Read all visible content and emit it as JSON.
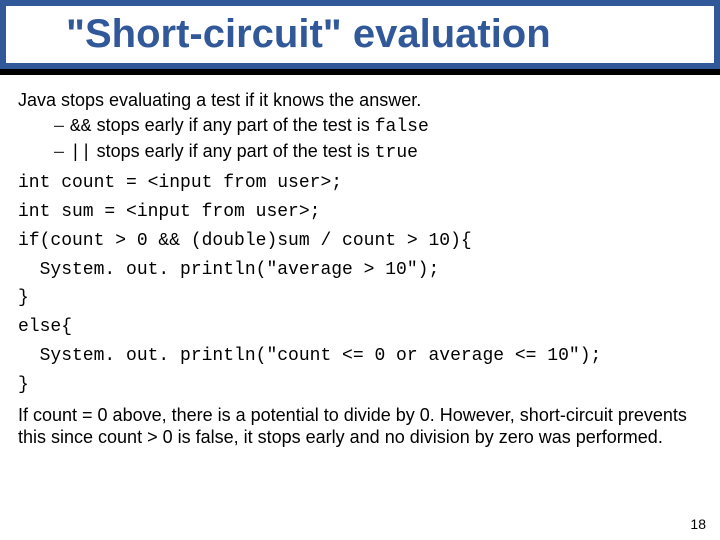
{
  "title": "\"Short-circuit\" evaluation",
  "lead": "Java stops evaluating a test if it knows the answer.",
  "bullets": [
    {
      "op": "&&",
      "text_before": "",
      "text_after": " stops early if any part of the test is ",
      "tail": "false"
    },
    {
      "op": "||",
      "text_before": "",
      "text_after": " stops early if any part of the test is ",
      "tail": "true"
    }
  ],
  "code": "int count = <input from user>;\nint sum = <input from user>;\nif(count > 0 && (double)sum / count > 10){\n  System. out. println(\"average > 10\");\n}\nelse{\n  System. out. println(\"count <= 0 or average <= 10\");\n}",
  "explain": "If count = 0 above, there is a potential to divide by 0. However, short-circuit prevents this since count > 0 is false, it stops early and no division by zero was performed.",
  "page_number": "18"
}
